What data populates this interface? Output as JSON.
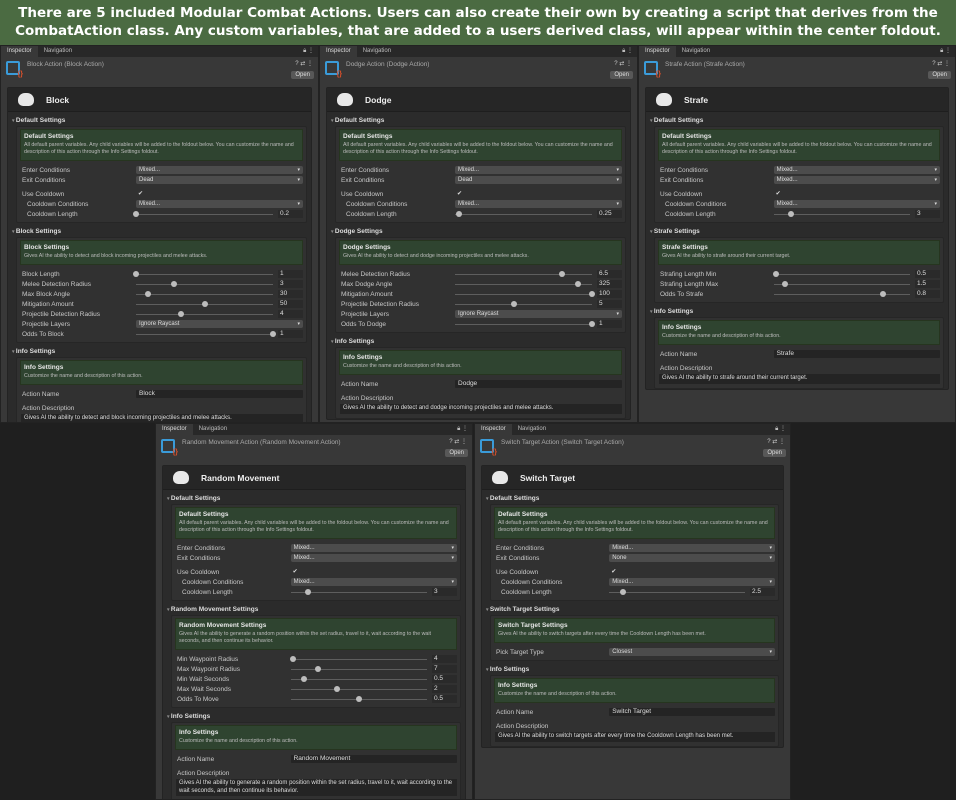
{
  "banner": "There are 5 included Modular Combat Actions. Users can also create their own by creating a script that derives from the CombatAction class. Any custom variables, that are added to a users derived class, will appear within the center foldout.",
  "tabs": {
    "inspector": "Inspector",
    "navigation": "Navigation",
    "open": "Open"
  },
  "colors": {
    "banner": "#4b6b42",
    "panel": "#383838",
    "green_box": "#2f4430"
  },
  "panels": [
    {
      "title": "Block Action (Block Action)",
      "card_title": "Block",
      "sections": [
        {
          "foldout": "Default Settings",
          "box_title": "Default Settings",
          "box_desc": "All default parent variables. Any child variables will be added to the foldout below. You can customize the name and description of this action through the Info Settings foldout.",
          "rows": [
            {
              "label": "Enter Conditions",
              "type": "dropdown",
              "value": "Mixed..."
            },
            {
              "label": "Exit Conditions",
              "type": "dropdown",
              "value": "Dead"
            },
            {
              "label": "Use Cooldown",
              "type": "toggle",
              "value": "✔",
              "gap": true
            },
            {
              "label": "Cooldown Conditions",
              "type": "dropdown",
              "value": "Mixed...",
              "indent": true
            },
            {
              "label": "Cooldown Length",
              "type": "slider",
              "value": "0.2",
              "fraction": 0.0,
              "indent": true
            }
          ]
        },
        {
          "foldout": "Block Settings",
          "box_title": "Block Settings",
          "box_desc": "Gives AI the ability to detect and block incoming projectiles and melee attacks.",
          "rows": [
            {
              "label": "Block Length",
              "type": "slider",
              "value": "1",
              "fraction": 0.0
            },
            {
              "label": "Melee Detection Radius",
              "type": "slider",
              "value": "3",
              "fraction": 0.28
            },
            {
              "label": "Max Block Angle",
              "type": "slider",
              "value": "30",
              "fraction": 0.09
            },
            {
              "label": "Mitigation Amount",
              "type": "slider",
              "value": "50",
              "fraction": 0.5
            },
            {
              "label": "Projectile Detection Radius",
              "type": "slider",
              "value": "4",
              "fraction": 0.33
            },
            {
              "label": "Projectile Layers",
              "type": "dropdown",
              "value": "Ignore Raycast"
            },
            {
              "label": "Odds To Block",
              "type": "slider",
              "value": "1",
              "fraction": 1.0
            }
          ]
        },
        {
          "foldout": "Info Settings",
          "box_title": "Info Settings",
          "box_desc": "Customize the name and description of this action.",
          "rows": [
            {
              "label": "Action Name",
              "type": "text",
              "value": "Block"
            },
            {
              "label": "Action Description",
              "type": "label",
              "gap": true
            },
            {
              "type": "textarea",
              "value": "Gives AI the ability to detect and block incoming projectiles and melee attacks."
            }
          ]
        }
      ]
    },
    {
      "title": "Dodge Action (Dodge Action)",
      "card_title": "Dodge",
      "sections": [
        {
          "foldout": "Default Settings",
          "box_title": "Default Settings",
          "box_desc": "All default parent variables. Any child variables will be added to the foldout below. You can customize the name and description of this action through the Info Settings foldout.",
          "rows": [
            {
              "label": "Enter Conditions",
              "type": "dropdown",
              "value": "Mixed..."
            },
            {
              "label": "Exit Conditions",
              "type": "dropdown",
              "value": "Dead"
            },
            {
              "label": "Use Cooldown",
              "type": "toggle",
              "value": "✔",
              "gap": true
            },
            {
              "label": "Cooldown Conditions",
              "type": "dropdown",
              "value": "Mixed...",
              "indent": true
            },
            {
              "label": "Cooldown Length",
              "type": "slider",
              "value": "0.25",
              "fraction": 0.03,
              "indent": true
            }
          ]
        },
        {
          "foldout": "Dodge Settings",
          "box_title": "Dodge Settings",
          "box_desc": "Gives AI the ability to detect and dodge incoming projectiles and melee attacks.",
          "rows": [
            {
              "label": "Melee Detection Radius",
              "type": "slider",
              "value": "6.5",
              "fraction": 0.78
            },
            {
              "label": "Max Dodge Angle",
              "type": "slider",
              "value": "325",
              "fraction": 0.9
            },
            {
              "label": "Mitigation Amount",
              "type": "slider",
              "value": "100",
              "fraction": 1.0
            },
            {
              "label": "Projectile Detection Radius",
              "type": "slider",
              "value": "5",
              "fraction": 0.43
            },
            {
              "label": "Projectile Layers",
              "type": "dropdown",
              "value": "Ignore Raycast"
            },
            {
              "label": "Odds To Dodge",
              "type": "slider",
              "value": "1",
              "fraction": 1.0
            }
          ]
        },
        {
          "foldout": "Info Settings",
          "box_title": "Info Settings",
          "box_desc": "Customize the name and description of this action.",
          "rows": [
            {
              "label": "Action Name",
              "type": "text",
              "value": "Dodge"
            },
            {
              "label": "Action Description",
              "type": "label",
              "gap": true
            },
            {
              "type": "textarea",
              "value": "Gives AI the ability to detect and dodge incoming projectiles and melee attacks."
            }
          ]
        }
      ]
    },
    {
      "title": "Strafe Action (Strafe Action)",
      "card_title": "Strafe",
      "sections": [
        {
          "foldout": "Default Settings",
          "box_title": "Default Settings",
          "box_desc": "All default parent variables. Any child variables will be added to the foldout below. You can customize the name and description of this action through the Info Settings foldout.",
          "rows": [
            {
              "label": "Enter Conditions",
              "type": "dropdown",
              "value": "Mixed..."
            },
            {
              "label": "Exit Conditions",
              "type": "dropdown",
              "value": "Mixed..."
            },
            {
              "label": "Use Cooldown",
              "type": "toggle",
              "value": "✔",
              "gap": true
            },
            {
              "label": "Cooldown Conditions",
              "type": "dropdown",
              "value": "Mixed...",
              "indent": true
            },
            {
              "label": "Cooldown Length",
              "type": "slider",
              "value": "3",
              "fraction": 0.13,
              "indent": true
            }
          ]
        },
        {
          "foldout": "Strafe Settings",
          "box_title": "Strafe Settings",
          "box_desc": "Gives AI the ability to strafe around their current target.",
          "rows": [
            {
              "label": "Strafing Length Min",
              "type": "slider",
              "value": "0.5",
              "fraction": 0.02
            },
            {
              "label": "Strafing Length Max",
              "type": "slider",
              "value": "1.5",
              "fraction": 0.08
            },
            {
              "label": "Odds To Strafe",
              "type": "slider",
              "value": "0.8",
              "fraction": 0.8
            }
          ]
        },
        {
          "foldout": "Info Settings",
          "box_title": "Info Settings",
          "box_desc": "Customize the name and description of this action.",
          "rows": [
            {
              "label": "Action Name",
              "type": "text",
              "value": "Strafe"
            },
            {
              "label": "Action Description",
              "type": "label",
              "gap": true
            },
            {
              "type": "textarea",
              "value": "Gives AI the ability to strafe around their current target."
            }
          ]
        }
      ]
    },
    {
      "title": "Random Movement Action (Random Movement Action)",
      "card_title": "Random Movement",
      "sections": [
        {
          "foldout": "Default Settings",
          "box_title": "Default Settings",
          "box_desc": "All default parent variables. Any child variables will be added to the foldout below. You can customize the name and description of this action through the Info Settings foldout.",
          "rows": [
            {
              "label": "Enter Conditions",
              "type": "dropdown",
              "value": "Mixed..."
            },
            {
              "label": "Exit Conditions",
              "type": "dropdown",
              "value": "Mixed..."
            },
            {
              "label": "Use Cooldown",
              "type": "toggle",
              "value": "✔",
              "gap": true
            },
            {
              "label": "Cooldown Conditions",
              "type": "dropdown",
              "value": "Mixed...",
              "indent": true
            },
            {
              "label": "Cooldown Length",
              "type": "slider",
              "value": "3",
              "fraction": 0.13,
              "indent": true
            }
          ]
        },
        {
          "foldout": "Random Movement Settings",
          "box_title": "Random Movement Settings",
          "box_desc": "Gives AI the ability to generate a random position within the set radius, travel to it, wait according to the wait seconds, and then continue its behavior.",
          "rows": [
            {
              "label": "Min Waypoint Radius",
              "type": "slider",
              "value": "4",
              "fraction": 0.02
            },
            {
              "label": "Max Waypoint Radius",
              "type": "slider",
              "value": "7",
              "fraction": 0.2
            },
            {
              "label": "Min Wait Seconds",
              "type": "slider",
              "value": "0.5",
              "fraction": 0.1
            },
            {
              "label": "Max Wait Seconds",
              "type": "slider",
              "value": "2",
              "fraction": 0.34
            },
            {
              "label": "Odds To Move",
              "type": "slider",
              "value": "0.5",
              "fraction": 0.5
            }
          ]
        },
        {
          "foldout": "Info Settings",
          "box_title": "Info Settings",
          "box_desc": "Customize the name and description of this action.",
          "rows": [
            {
              "label": "Action Name",
              "type": "text",
              "value": "Random Movement"
            },
            {
              "label": "Action Description",
              "type": "label",
              "gap": true
            },
            {
              "type": "textarea",
              "value": "Gives AI the ability to generate a random position within the set radius, travel to it, wait according to the wait seconds, and then continue its behavior."
            }
          ]
        }
      ]
    },
    {
      "title": "Switch Target Action (Switch Target Action)",
      "card_title": "Switch Target",
      "sections": [
        {
          "foldout": "Default Settings",
          "box_title": "Default Settings",
          "box_desc": "All default parent variables. Any child variables will be added to the foldout below. You can customize the name and description of this action through the Info Settings foldout.",
          "rows": [
            {
              "label": "Enter Conditions",
              "type": "dropdown",
              "value": "Mixed..."
            },
            {
              "label": "Exit Conditions",
              "type": "dropdown",
              "value": "None"
            },
            {
              "label": "Use Cooldown",
              "type": "toggle",
              "value": "✔",
              "gap": true
            },
            {
              "label": "Cooldown Conditions",
              "type": "dropdown",
              "value": "Mixed...",
              "indent": true
            },
            {
              "label": "Cooldown Length",
              "type": "slider",
              "value": "2.5",
              "fraction": 0.1,
              "indent": true
            }
          ]
        },
        {
          "foldout": "Switch Target Settings",
          "box_title": "Switch Target Settings",
          "box_desc": "Gives AI the ability to switch targets after every time the Cooldown Length has been met.",
          "rows": [
            {
              "label": "Pick Target Type",
              "type": "dropdown",
              "value": "Closest",
              "gap": true
            }
          ]
        },
        {
          "foldout": "Info Settings",
          "box_title": "Info Settings",
          "box_desc": "Customize the name and description of this action.",
          "rows": [
            {
              "label": "Action Name",
              "type": "text",
              "value": "Switch Target"
            },
            {
              "label": "Action Description",
              "type": "label",
              "gap": true
            },
            {
              "type": "textarea",
              "value": "Gives AI the ability to switch targets after every time the Cooldown Length has been met."
            }
          ]
        }
      ]
    }
  ]
}
